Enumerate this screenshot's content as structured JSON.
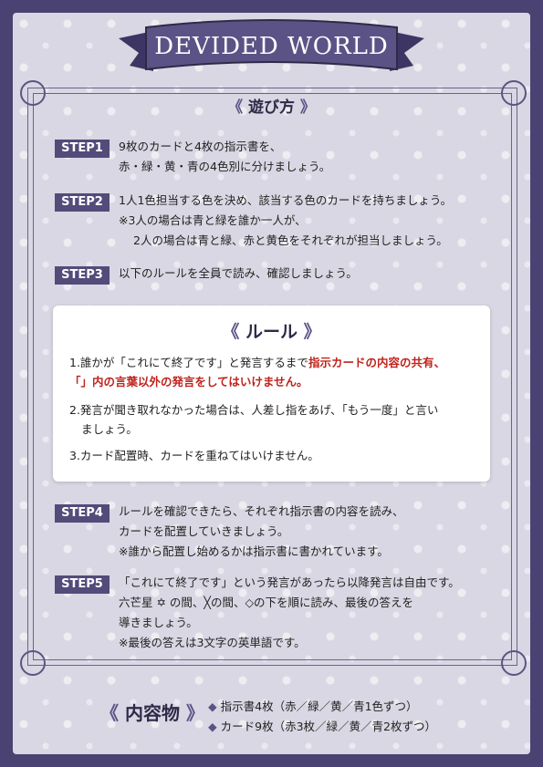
{
  "title": "DEVIDED WORLD",
  "how_to_play": {
    "label": "遊び方"
  },
  "steps": [
    {
      "label": "STEP1",
      "lines": [
        "9枚のカードと4枚の指示書を、",
        "赤・緑・黄・青の4色別に分けましょう。"
      ]
    },
    {
      "label": "STEP2",
      "lines": [
        "1人1色担当する色を決め、該当する色のカードを持ちましょう。",
        "※3人の場合は青と緑を誰か一人が、",
        "2人の場合は青と緑、赤と黄色をそれぞれが担当しましょう。"
      ]
    },
    {
      "label": "STEP3",
      "lines": [
        "以下のルールを全員で読み、確認しましょう。"
      ]
    },
    {
      "label": "STEP4",
      "lines": [
        "ルールを確認できたら、それぞれ指示書の内容を読み、",
        "カードを配置していきましょう。",
        "※誰から配置し始めるかは指示書に書かれています。"
      ]
    },
    {
      "label": "STEP5",
      "lines": [
        "「これにて終了です」という発言があったら以降発言は自由です。",
        "六芒星 ✡ の間、╳の間、◇の下を順に読み、最後の答えを",
        "導きましょう。",
        "※最後の答えは3文字の英単語です。"
      ]
    }
  ],
  "rules": {
    "label": "ルール",
    "rule1_a": "1.誰かが「これにて終了です」と発言するまで",
    "rule1_b": "指示カードの内容の共有、",
    "rule1_c": "「」内の言葉以外の発言をしてはいけません。",
    "rule2_a": "2.発言が聞き取れなかった場合は、人差し指をあげ、「もう一度」と言い",
    "rule2_b": "ましょう。",
    "rule3": "3.カード配置時、カードを重ねてはいけません。"
  },
  "contents": {
    "label": "内容物",
    "items": [
      "指示書4枚（赤／緑／黄／青1色ずつ）",
      "カード9枚（赤3枚／緑／黄／青2枚ずつ）"
    ]
  },
  "colors": {
    "navy": "#4a4272",
    "panel": "#d9d7e3",
    "accent": "#534b7a",
    "red": "#c0231c"
  }
}
